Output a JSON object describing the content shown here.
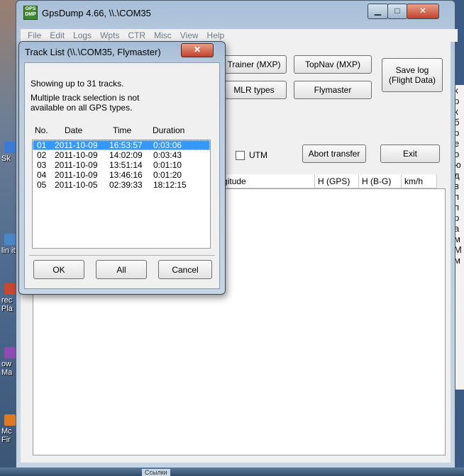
{
  "main_window": {
    "title": "GpsDump 4.66, \\\\.\\COM35",
    "logo_text": "GPS DMP",
    "menu": [
      "File",
      "Edit",
      "Logs",
      "Wpts",
      "CTR",
      "Misc",
      "View",
      "Help"
    ],
    "buttons": {
      "trainer": "Trainer (MXP)",
      "topnav": "TopNav (MXP)",
      "save_log": "Save log\n(Flight Data)",
      "mlr": "MLR types",
      "flymaster": "Flymaster",
      "abort": "Abort transfer",
      "exit": "Exit"
    },
    "utm_label": "UTM",
    "columns": [
      "Longitude",
      "H (GPS)",
      "H (B-G)",
      "km/h"
    ]
  },
  "dialog": {
    "title": "Track List (\\\\.\\COM35, Flymaster)",
    "showing": "Showing up to 31 tracks.",
    "note_line1": "Multiple track selection is not",
    "note_line2": "available on all GPS types.",
    "headers": {
      "no": "No.",
      "date": "Date",
      "time": "Time",
      "duration": "Duration"
    },
    "tracks": [
      {
        "no": "01",
        "date": "2011-10-09",
        "time": "16:53:57",
        "duration": "0:03:06",
        "selected": true
      },
      {
        "no": "02",
        "date": "2011-10-09",
        "time": "14:02:09",
        "duration": "0:03:43",
        "selected": false
      },
      {
        "no": "03",
        "date": "2011-10-09",
        "time": "13:51:14",
        "duration": "0:01:10",
        "selected": false
      },
      {
        "no": "04",
        "date": "2011-10-09",
        "time": "13:46:16",
        "duration": "0:01:20",
        "selected": false
      },
      {
        "no": "05",
        "date": "2011-10-05",
        "time": "02:39:33",
        "duration": "18:12:15",
        "selected": false
      }
    ],
    "ok": "OK",
    "all": "All",
    "cancel": "Cancel"
  },
  "desktop": {
    "icons": [
      "Sk",
      "lin itti",
      "rec Pla",
      "ow Ma",
      "Mc Fir"
    ],
    "bg_text": "к р к б р е о ю д в п п р а м М м",
    "taskbar_item": "Ссылки"
  }
}
